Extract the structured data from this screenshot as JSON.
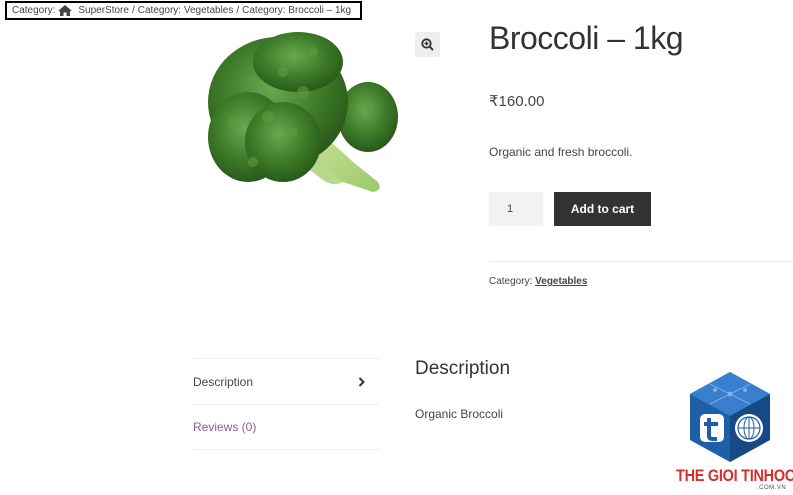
{
  "breadcrumb": {
    "prefix1": "Category:",
    "home": "SuperStore",
    "sep1": "/",
    "prefix2": "Category: Vegetables",
    "sep2": "/",
    "prefix3": "Category: Broccoli – 1kg"
  },
  "product": {
    "title": "Broccoli – 1kg",
    "price": "₹160.00",
    "short_description": "Organic and fresh broccoli.",
    "quantity": "1",
    "add_to_cart_label": "Add to cart",
    "category_label": "Category:",
    "category_link": "Vegetables",
    "image_icon": "broccoli-image",
    "zoom_icon": "zoom-in-icon"
  },
  "tabs": [
    {
      "label": "Description"
    },
    {
      "label": "Reviews (0)"
    }
  ],
  "description": {
    "heading": "Description",
    "body": "Organic Broccoli"
  },
  "watermark": {
    "text": "THE GIOI TINHOC",
    "sub": ".COM.VN"
  },
  "colors": {
    "button_bg": "#333333",
    "link_purple": "#96588a",
    "brand_red": "#d62d2d",
    "brand_blue": "#1f5fa8"
  }
}
